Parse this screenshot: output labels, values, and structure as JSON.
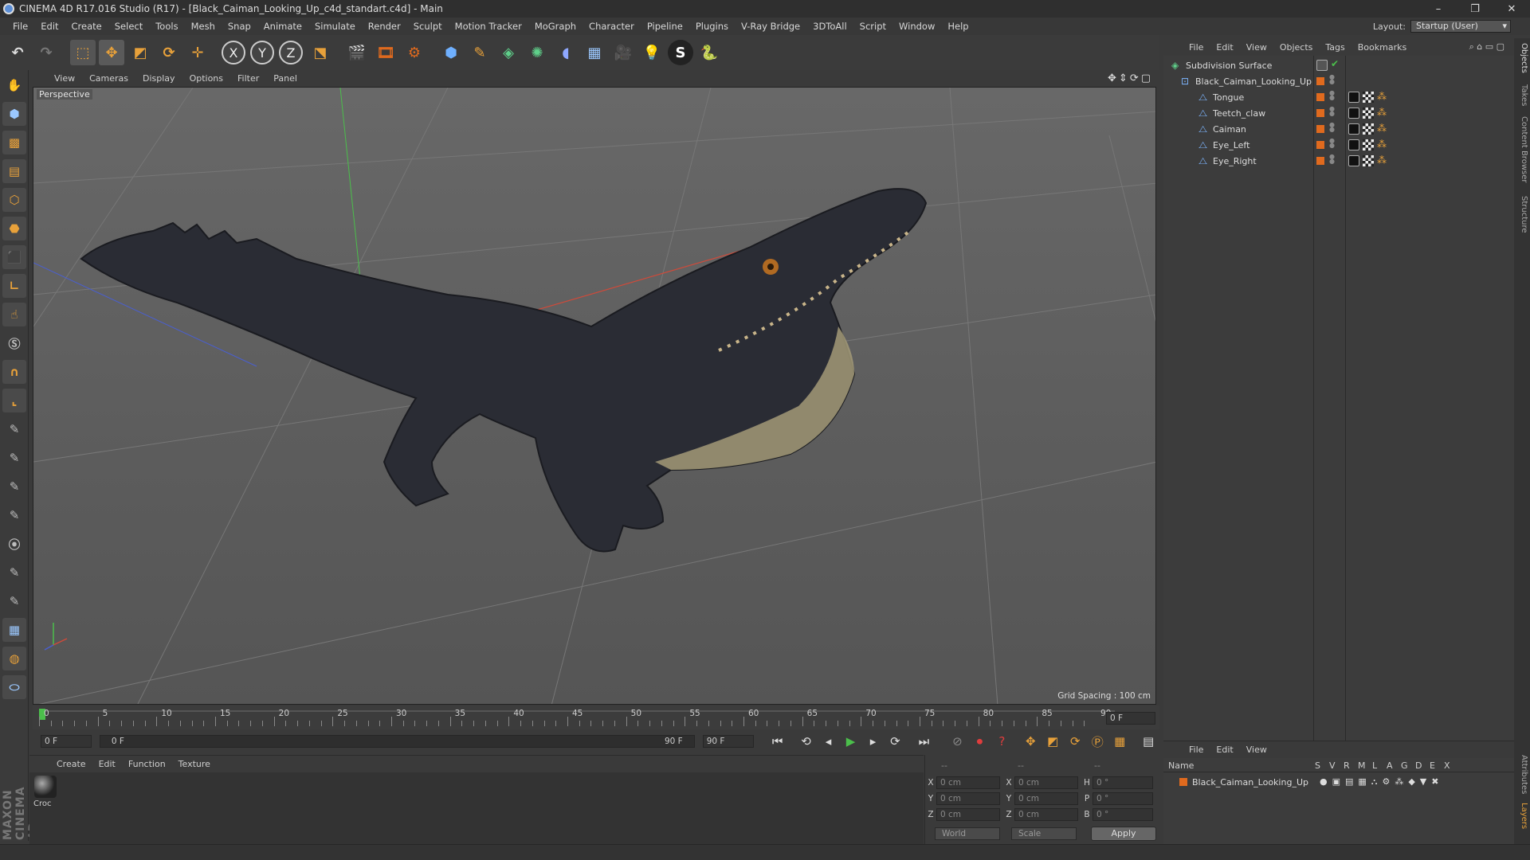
{
  "window": {
    "title": "CINEMA 4D R17.016 Studio (R17) - [Black_Caiman_Looking_Up_c4d_standart.c4d] - Main",
    "controls": [
      "–",
      "❐",
      "✕"
    ]
  },
  "menubar": {
    "items": [
      "File",
      "Edit",
      "Create",
      "Select",
      "Tools",
      "Mesh",
      "Snap",
      "Animate",
      "Simulate",
      "Render",
      "Sculpt",
      "Motion Tracker",
      "MoGraph",
      "Character",
      "Pipeline",
      "Plugins",
      "V-Ray Bridge",
      "3DToAll",
      "Script",
      "Window",
      "Help"
    ],
    "layout_label": "Layout:",
    "layout_value": "Startup (User)"
  },
  "toolbar": {
    "axis_x": "X",
    "axis_y": "Y",
    "axis_z": "Z"
  },
  "viewport": {
    "menu": [
      "View",
      "Cameras",
      "Display",
      "Options",
      "Filter",
      "Panel"
    ],
    "label": "Perspective",
    "grid_spacing": "Grid Spacing : 100 cm"
  },
  "timeline": {
    "ticks": [
      "0",
      "5",
      "10",
      "15",
      "20",
      "25",
      "30",
      "35",
      "40",
      "45",
      "50",
      "55",
      "60",
      "65",
      "70",
      "75",
      "80",
      "85",
      "90"
    ],
    "current_frame_field": "0 F",
    "start_field": "0 F",
    "range_start": "0 F",
    "range_end": "90 F",
    "end_field": "90 F",
    "frame_display": "0 F"
  },
  "materials": {
    "menu": [
      "Create",
      "Edit",
      "Function",
      "Texture"
    ],
    "items": [
      {
        "name": "Croc"
      }
    ]
  },
  "coordinates": {
    "header": [
      "--",
      "--",
      "--"
    ],
    "rows": [
      {
        "a": "X",
        "av": "0 cm",
        "b": "X",
        "bv": "0 cm",
        "c": "H",
        "cv": "0 °"
      },
      {
        "a": "Y",
        "av": "0 cm",
        "b": "Y",
        "bv": "0 cm",
        "c": "P",
        "cv": "0 °"
      },
      {
        "a": "Z",
        "av": "0 cm",
        "b": "Z",
        "bv": "0 cm",
        "c": "B",
        "cv": "0 °"
      }
    ],
    "space_select": "World",
    "mode_select": "Scale",
    "apply": "Apply"
  },
  "objects": {
    "menu": [
      "File",
      "Edit",
      "View",
      "Objects",
      "Tags",
      "Bookmarks"
    ],
    "tree": [
      {
        "name": "Subdivision Surface",
        "indent": 0
      },
      {
        "name": "Black_Caiman_Looking_Up",
        "indent": 1
      },
      {
        "name": "Tongue",
        "indent": 2
      },
      {
        "name": "Teetch_claw",
        "indent": 2
      },
      {
        "name": "Caiman",
        "indent": 2
      },
      {
        "name": "Eye_Left",
        "indent": 2
      },
      {
        "name": "Eye_Right",
        "indent": 2
      }
    ]
  },
  "layers": {
    "menu": [
      "File",
      "Edit",
      "View"
    ],
    "columns": [
      "Name",
      "S",
      "V",
      "R",
      "M",
      "L",
      "A",
      "G",
      "D",
      "E",
      "X"
    ],
    "rows": [
      {
        "name": "Black_Caiman_Looking_Up"
      }
    ]
  },
  "right_tabs": [
    "Objects",
    "Takes",
    "Content Browser",
    "Structure",
    "Attributes",
    "Layers"
  ],
  "colors": {
    "accent_orange": "#e8a13a",
    "tag_orange": "#e06a1e",
    "axis_red": "#d04a3a",
    "axis_green": "#4bbf4b",
    "axis_blue": "#4a5fd0"
  }
}
